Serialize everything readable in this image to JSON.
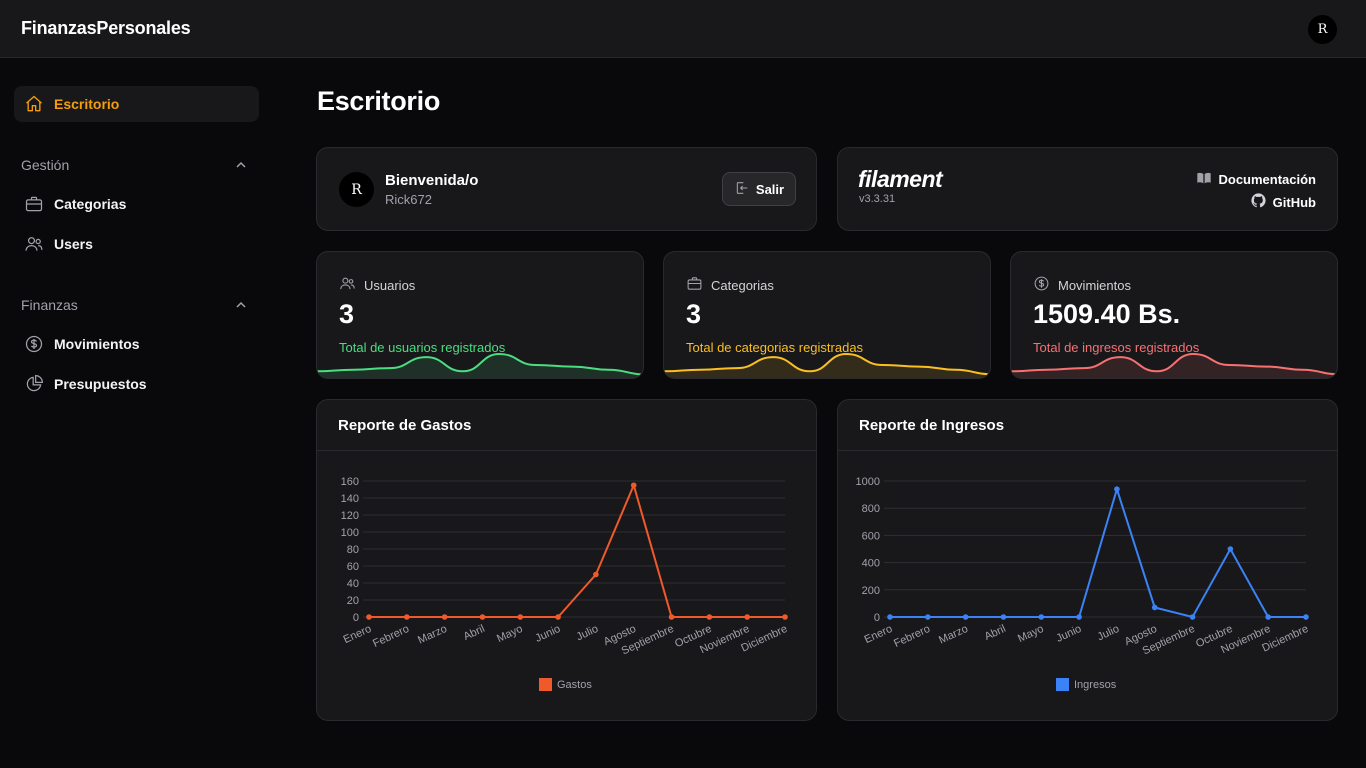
{
  "app": {
    "title": "FinanzasPersonales",
    "user_initial": "R"
  },
  "sidebar": {
    "dashboard": {
      "label": "Escritorio"
    },
    "groups": [
      {
        "label": "Gestión",
        "items": [
          {
            "label": "Categorias",
            "icon": "briefcase-icon"
          },
          {
            "label": "Users",
            "icon": "users-icon"
          }
        ]
      },
      {
        "label": "Finanzas",
        "items": [
          {
            "label": "Movimientos",
            "icon": "dollar-circle-icon"
          },
          {
            "label": "Presupuestos",
            "icon": "chart-pie-icon"
          }
        ]
      }
    ]
  },
  "page": {
    "title": "Escritorio"
  },
  "welcome": {
    "initial": "R",
    "title": "Bienvenida/o",
    "username": "Rick672",
    "logout_label": "Salir"
  },
  "filament": {
    "logo": "filament",
    "version": "v3.3.31",
    "docs_label": "Documentación",
    "github_label": "GitHub"
  },
  "stats": [
    {
      "label": "Usuarios",
      "value": "3",
      "description": "Total de usuarios registrados",
      "color": "#4ade80",
      "icon": "users-icon",
      "sparkline": [
        3,
        4,
        5,
        12,
        3,
        14,
        7,
        6,
        4,
        1
      ]
    },
    {
      "label": "Categorias",
      "value": "3",
      "description": "Total de categorias registradas",
      "color": "#fbbf24",
      "icon": "briefcase-icon",
      "sparkline": [
        3,
        4,
        5,
        12,
        3,
        14,
        7,
        6,
        4,
        1
      ]
    },
    {
      "label": "Movimientos",
      "value": "1509.40 Bs.",
      "description": "Total de ingresos registrados",
      "color": "#f87171",
      "icon": "dollar-circle-icon",
      "sparkline": [
        3,
        4,
        5,
        12,
        3,
        14,
        7,
        6,
        4,
        1
      ]
    }
  ],
  "chart_data": [
    {
      "type": "line",
      "title": "Reporte de Gastos",
      "categories": [
        "Enero",
        "Febrero",
        "Marzo",
        "Abril",
        "Mayo",
        "Junio",
        "Julio",
        "Agosto",
        "Septiembre",
        "Octubre",
        "Noviembre",
        "Diciembre"
      ],
      "series": [
        {
          "name": "Gastos",
          "values": [
            0,
            0,
            0,
            0,
            0,
            0,
            50,
            155,
            0,
            0,
            0,
            0
          ]
        }
      ],
      "yticks": [
        0,
        20,
        40,
        60,
        80,
        100,
        120,
        140,
        160
      ],
      "ylim": [
        0,
        160
      ],
      "color": "#f05a2b",
      "legend": "bottom"
    },
    {
      "type": "line",
      "title": "Reporte de Ingresos",
      "categories": [
        "Enero",
        "Febrero",
        "Marzo",
        "Abril",
        "Mayo",
        "Junio",
        "Julio",
        "Agosto",
        "Septiembre",
        "Octubre",
        "Noviembre",
        "Diciembre"
      ],
      "series": [
        {
          "name": "Ingresos",
          "values": [
            0,
            0,
            0,
            0,
            0,
            0,
            940,
            70,
            0,
            500,
            0,
            0
          ]
        }
      ],
      "yticks": [
        0,
        200,
        400,
        600,
        800,
        1000
      ],
      "ylim": [
        0,
        1000
      ],
      "color": "#3b82f6",
      "legend": "bottom"
    }
  ]
}
